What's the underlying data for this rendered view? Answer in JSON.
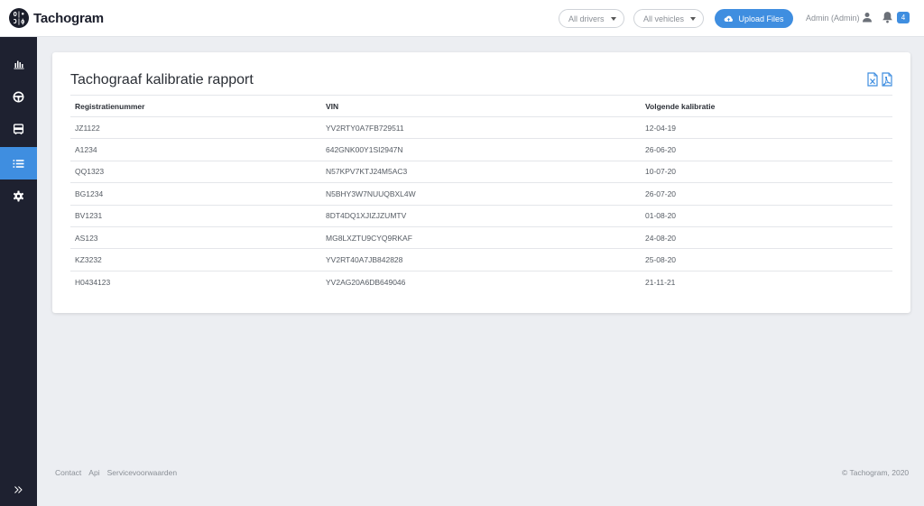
{
  "app": {
    "name": "Tachogram",
    "logo_mark_top": "O|•",
    "logo_mark_bottom": "Ɔ|ф"
  },
  "header": {
    "drivers_filter": "All drivers",
    "vehicles_filter": "All vehicles",
    "upload_label": "Upload Files",
    "user_label": "Admin (Admin)",
    "notification_count": "4"
  },
  "sidebar": {
    "items": [
      {
        "name": "dashboard",
        "icon": "bar-chart-icon"
      },
      {
        "name": "drivers",
        "icon": "steering-wheel-icon"
      },
      {
        "name": "vehicles",
        "icon": "bus-icon"
      },
      {
        "name": "reports",
        "icon": "list-icon",
        "active": true
      },
      {
        "name": "settings",
        "icon": "gear-icon"
      }
    ]
  },
  "report": {
    "title": "Tachograaf kalibratie rapport",
    "columns": [
      "Registratienummer",
      "VIN",
      "Volgende kalibratie"
    ],
    "rows": [
      [
        "JZ1122",
        "YV2RTY0A7FB729511",
        "12-04-19"
      ],
      [
        "A1234",
        "642GNK00Y1SI2947N",
        "26-06-20"
      ],
      [
        "QQ1323",
        "N57KPV7KTJ24M5AC3",
        "10-07-20"
      ],
      [
        "BG1234",
        "N5BHY3W7NUUQBXL4W",
        "26-07-20"
      ],
      [
        "BV1231",
        "8DT4DQ1XJIZJZUMTV",
        "01-08-20"
      ],
      [
        "AS123",
        "MG8LXZTU9CYQ9RKAF",
        "24-08-20"
      ],
      [
        "KZ3232",
        "YV2RT40A7JB842828",
        "25-08-20"
      ],
      [
        "H0434123",
        "YV2AG20A6DB649046",
        "21-11-21"
      ]
    ]
  },
  "footer": {
    "links": [
      "Contact",
      "Api",
      "Servicevoorwaarden"
    ],
    "copyright": "© Tachogram, 2020"
  },
  "colors": {
    "accent": "#3f8ee0",
    "sidebar": "#1e2130",
    "background": "#eceef2"
  }
}
